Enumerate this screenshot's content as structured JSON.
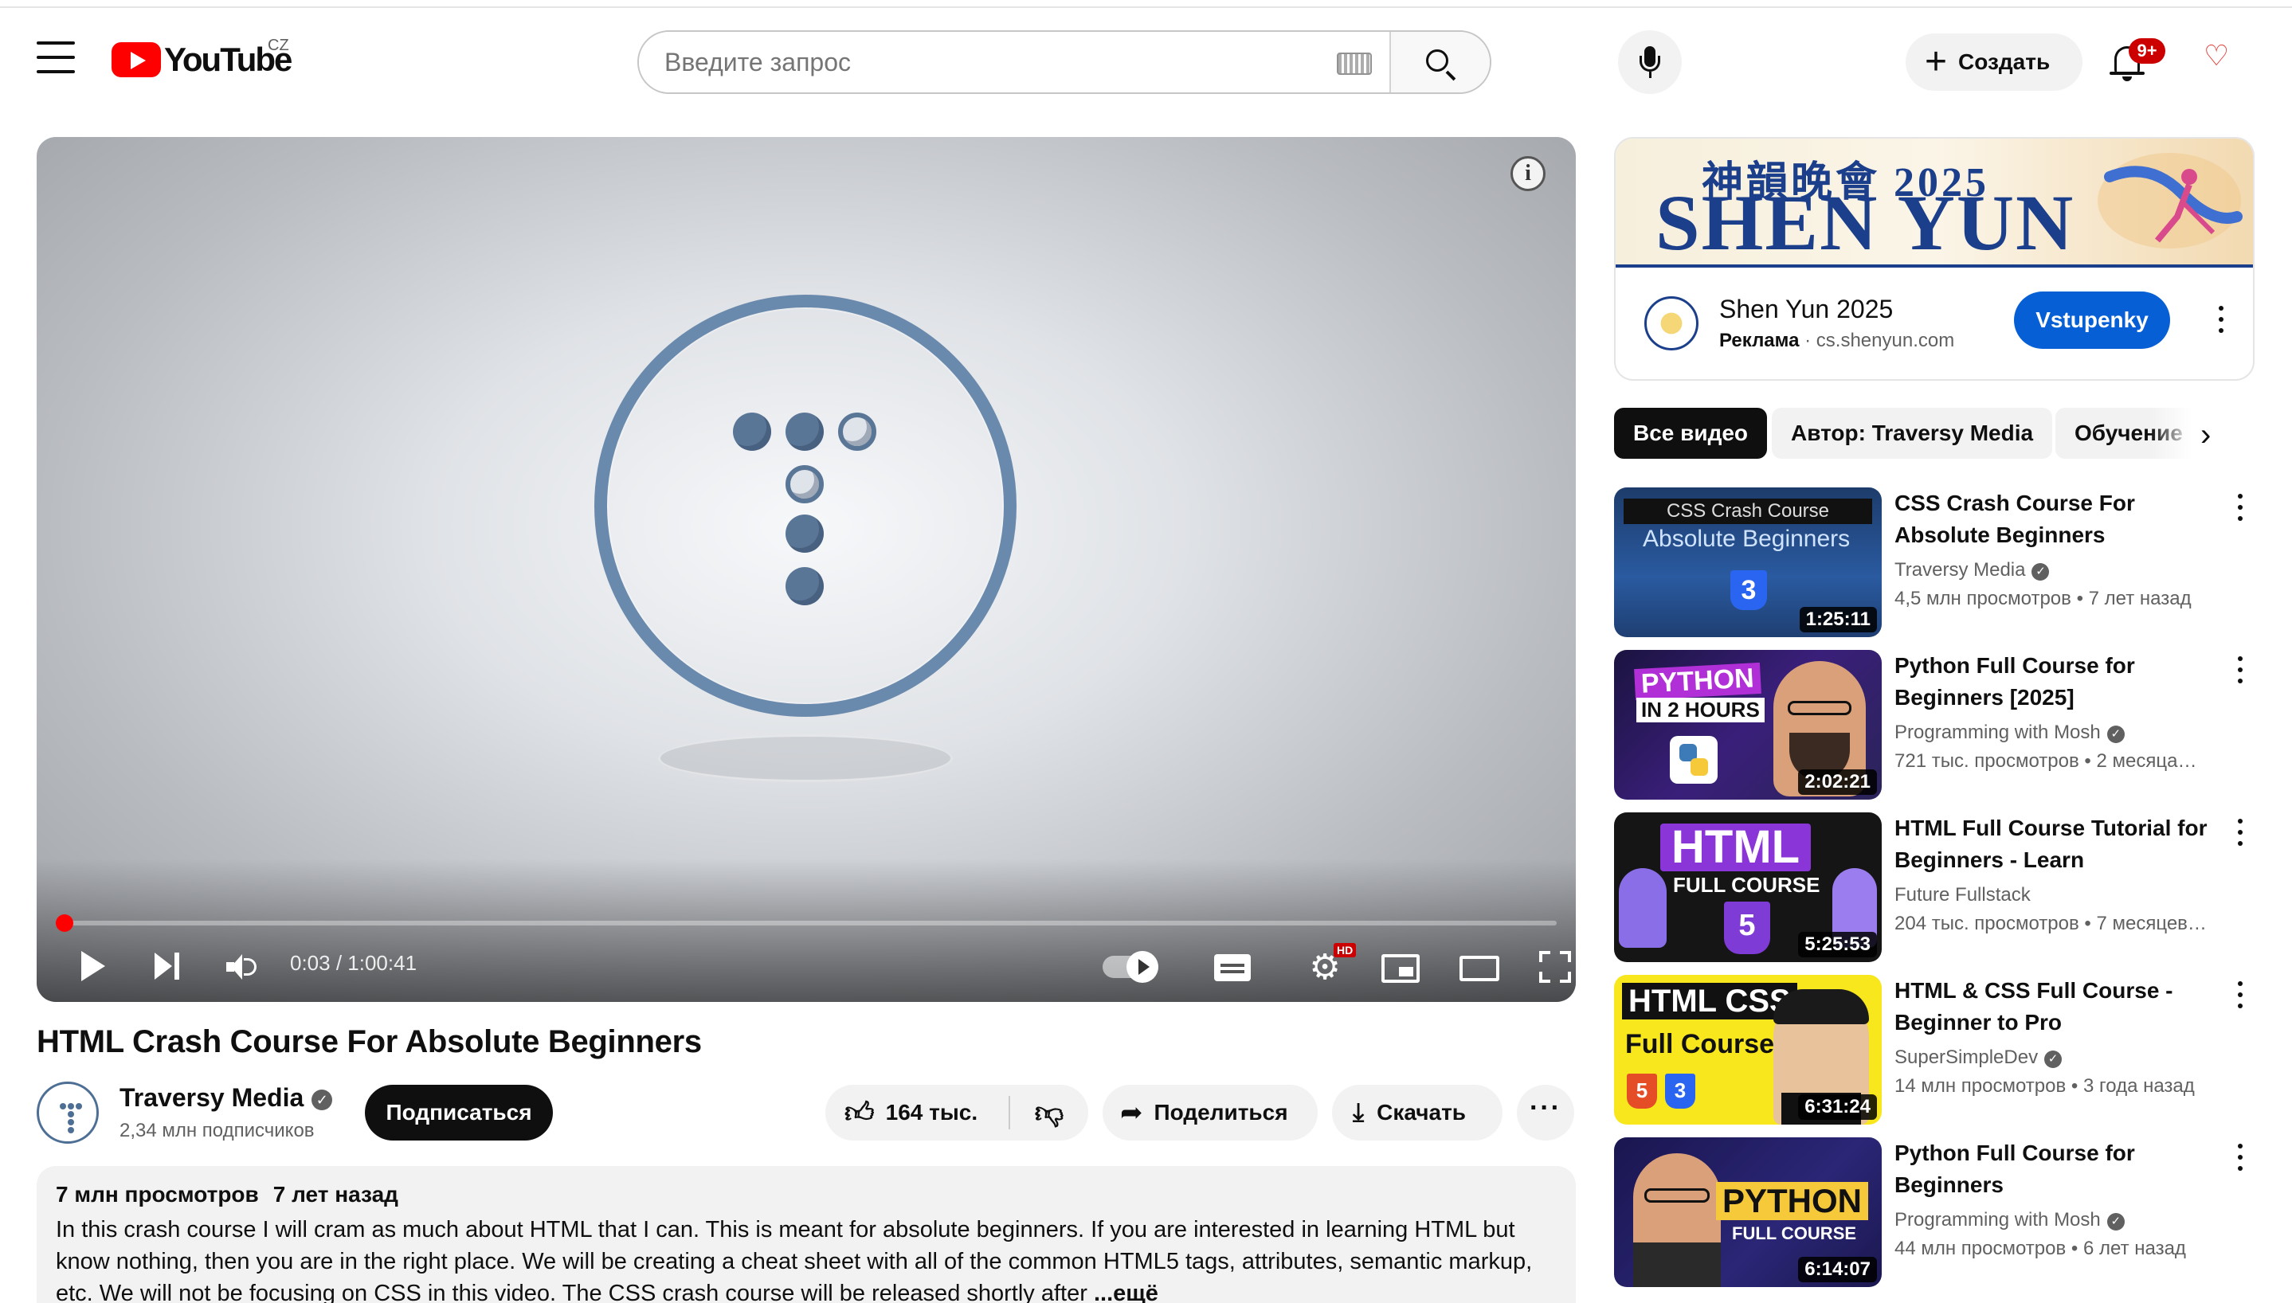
{
  "header": {
    "logo_text": "YouTube",
    "country_code": "CZ",
    "search_placeholder": "Введите запрос",
    "create_label": "Создать",
    "notifications_badge": "9+"
  },
  "player": {
    "current_time": "0:03",
    "duration": "1:00:41",
    "progress_fraction": 0.0008,
    "hd_badge": "HD"
  },
  "video": {
    "title": "HTML Crash Course For Absolute Beginners",
    "channel_name": "Traversy Media",
    "subscribers": "2,34 млн подписчиков",
    "subscribe_label": "Подписаться",
    "likes": "164 тыс.",
    "share_label": "Поделиться",
    "download_label": "Скачать"
  },
  "description": {
    "views": "7 млн просмотров",
    "date": "7 лет назад",
    "text": "In this crash course I will cram as much about HTML that I can. This is meant for absolute beginners. If you are interested in learning HTML but know nothing, then you are in the right place. We will be creating a cheat sheet with all of the common HTML5 tags, attributes, semantic markup, etc. We will not be focusing on CSS in this video. The CSS crash course will be released shortly after",
    "more_label": "...ещё"
  },
  "ad": {
    "banner_line1": "神韻晚會 2025",
    "banner_line2": "SHEN YUN",
    "name": "Shen Yun 2025",
    "label": "Реклама",
    "domain": "cs.shenyun.com",
    "cta": "Vstupenky"
  },
  "chips": [
    {
      "label": "Все видео",
      "active": true
    },
    {
      "label": "Автор: Traversy Media",
      "active": false
    },
    {
      "label": "Обучение",
      "active": false
    }
  ],
  "recommended": [
    {
      "title": "CSS Crash Course For Absolute Beginners",
      "channel": "Traversy Media",
      "verified": true,
      "views": "4,5 млн просмотров",
      "age": "7 лет назад",
      "duration": "1:25:11",
      "thumb_line1": "CSS Crash Course",
      "thumb_line2": "Absolute Beginners"
    },
    {
      "title": "Python Full Course for Beginners [2025]",
      "channel": "Programming with Mosh",
      "verified": true,
      "views": "721 тыс. просмотров",
      "age": "2 месяца…",
      "duration": "2:02:21",
      "thumb_line1": "PYTHON",
      "thumb_line2": "IN 2 HOURS"
    },
    {
      "title": "HTML Full Course Tutorial for Beginners - Learn EVERYTHIN…",
      "channel": "Future Fullstack",
      "verified": false,
      "views": "204 тыс. просмотров",
      "age": "7 месяцев…",
      "duration": "5:25:53",
      "thumb_line1": "HTML",
      "thumb_line2": "FULL COURSE"
    },
    {
      "title": "HTML & CSS Full Course - Beginner to Pro",
      "channel": "SuperSimpleDev",
      "verified": true,
      "views": "14 млн просмотров",
      "age": "3 года назад",
      "duration": "6:31:24",
      "thumb_line1": "HTML CSS",
      "thumb_line2": "Full Course"
    },
    {
      "title": "Python Full Course for Beginners",
      "channel": "Programming with Mosh",
      "verified": true,
      "views": "44 млн просмотров",
      "age": "6 лет назад",
      "duration": "6:14:07",
      "thumb_line1": "PYTHON",
      "thumb_line2": "FULL COURSE"
    }
  ],
  "colors": {
    "brand_red": "#ff0000",
    "cta_blue": "#065fd4",
    "text_primary": "#0f0f0f",
    "text_secondary": "#606060",
    "chip_bg": "#f2f2f2"
  },
  "icons": [
    "menu-icon",
    "youtube-logo-icon",
    "keyboard-icon",
    "search-icon",
    "microphone-icon",
    "plus-icon",
    "bell-icon",
    "heart-icon",
    "info-icon",
    "play-icon",
    "next-icon",
    "volume-icon",
    "autoplay-toggle-icon",
    "subtitles-icon",
    "settings-icon",
    "miniplayer-icon",
    "theater-icon",
    "fullscreen-icon",
    "verified-icon",
    "thumbs-up-icon",
    "thumbs-down-icon",
    "share-icon",
    "download-icon",
    "more-icon",
    "chevron-right-icon",
    "kebab-icon"
  ]
}
